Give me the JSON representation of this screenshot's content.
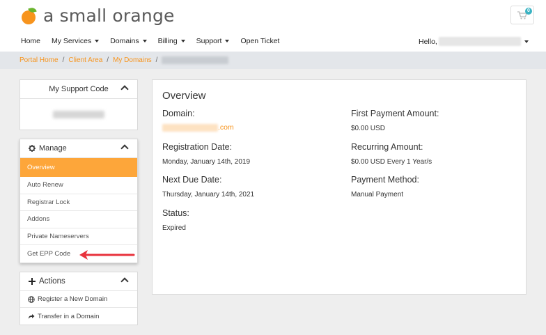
{
  "header": {
    "logo_text": "a small orange",
    "cart_count": "0"
  },
  "nav": {
    "items": [
      {
        "label": "Home",
        "dropdown": false
      },
      {
        "label": "My Services",
        "dropdown": true
      },
      {
        "label": "Domains",
        "dropdown": true
      },
      {
        "label": "Billing",
        "dropdown": true
      },
      {
        "label": "Support",
        "dropdown": true
      },
      {
        "label": "Open Ticket",
        "dropdown": false
      }
    ],
    "hello_label": "Hello,"
  },
  "breadcrumb": {
    "items": [
      "Portal Home",
      "Client Area",
      "My Domains"
    ],
    "separator": "/"
  },
  "support_panel": {
    "title": "My Support Code"
  },
  "manage_panel": {
    "title": "Manage",
    "items": [
      "Overview",
      "Auto Renew",
      "Registrar Lock",
      "Addons",
      "Private Nameservers",
      "Get EPP Code"
    ]
  },
  "actions_panel": {
    "title": "Actions",
    "items": [
      "Register a New Domain",
      "Transfer in a Domain"
    ]
  },
  "overview": {
    "title": "Overview",
    "domain_label": "Domain:",
    "domain_suffix": ".com",
    "registration_label": "Registration Date:",
    "registration_value": "Monday, January 14th, 2019",
    "next_due_label": "Next Due Date:",
    "next_due_value": "Thursday, January 14th, 2021",
    "status_label": "Status:",
    "status_value": "Expired",
    "first_payment_label": "First Payment Amount:",
    "first_payment_value": "$0.00 USD",
    "recurring_label": "Recurring Amount:",
    "recurring_value": "$0.00 USD Every 1 Year/s",
    "payment_method_label": "Payment Method:",
    "payment_method_value": "Manual Payment"
  },
  "colors": {
    "accent": "#f7941d",
    "active_menu": "#fda63a",
    "badge": "#3bb3c3",
    "arrow": "#e8323c"
  }
}
